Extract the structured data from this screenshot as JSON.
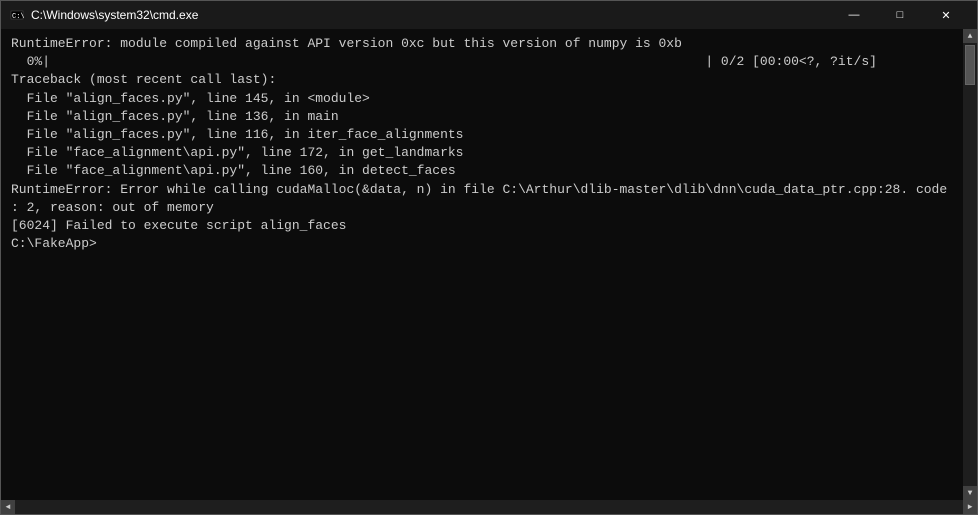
{
  "window": {
    "title": "C:\\Windows\\system32\\cmd.exe",
    "title_icon": "cmd-icon"
  },
  "controls": {
    "minimize": "—",
    "maximize": "□",
    "close": "✕"
  },
  "terminal": {
    "lines": [
      "RuntimeError: module compiled against API version 0xc but this version of numpy is 0xb",
      "  0%|                                                                                    | 0/2 [00:00<?, ?it/s]",
      "Traceback (most recent call last):",
      "  File \"align_faces.py\", line 145, in <module>",
      "  File \"align_faces.py\", line 136, in main",
      "  File \"align_faces.py\", line 116, in iter_face_alignments",
      "  File \"face_alignment\\api.py\", line 172, in get_landmarks",
      "  File \"face_alignment\\api.py\", line 160, in detect_faces",
      "RuntimeError: Error while calling cudaMalloc(&data, n) in file C:\\Arthur\\dlib-master\\dlib\\dnn\\cuda_data_ptr.cpp:28. code",
      ": 2, reason: out of memory",
      "[6024] Failed to execute script align_faces",
      "",
      "C:\\FakeApp>"
    ]
  }
}
